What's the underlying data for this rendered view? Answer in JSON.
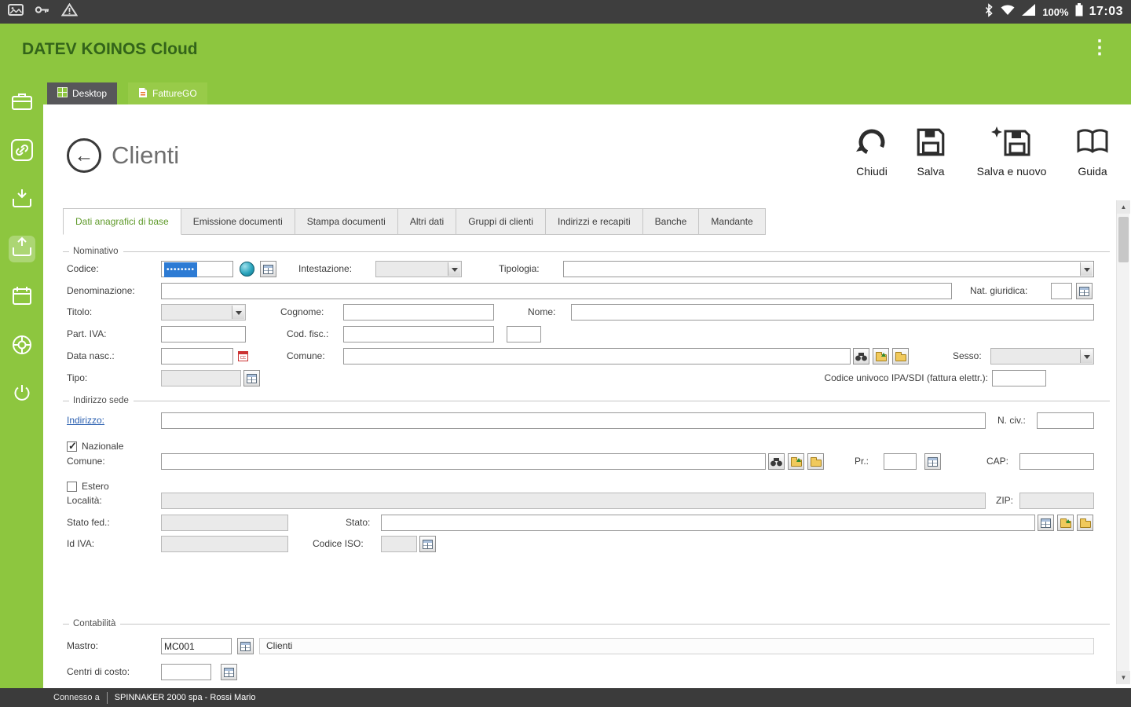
{
  "colors": {
    "accent_green": "#8dc63f",
    "selection_blue": "#2d7bd4",
    "bar_dark": "#3e3e3e"
  },
  "status_bar": {
    "time": "17:03",
    "battery": "100%"
  },
  "header": {
    "title": "DATEV KOINOS Cloud"
  },
  "window_tabs": {
    "desktop": "Desktop",
    "fatturego": "FattureGO"
  },
  "page": {
    "title": "Clienti"
  },
  "toolbar": {
    "close": "Chiudi",
    "save": "Salva",
    "save_new": "Salva e nuovo",
    "help": "Guida"
  },
  "form_tabs": [
    "Dati anagrafici di base",
    "Emissione documenti",
    "Stampa documenti",
    "Altri dati",
    "Gruppi di clienti",
    "Indirizzi e recapiti",
    "Banche",
    "Mandante"
  ],
  "nominativo": {
    "legend": "Nominativo",
    "codice": "Codice:",
    "codice_value": "••••••••",
    "intestazione": "Intestazione:",
    "tipologia": "Tipologia:",
    "denominazione": "Denominazione:",
    "nat_giuridica": "Nat. giuridica:",
    "titolo": "Titolo:",
    "cognome": "Cognome:",
    "nome": "Nome:",
    "part_iva": "Part. IVA:",
    "cod_fisc": "Cod. fisc.:",
    "data_nasc": "Data nasc.:",
    "comune": "Comune:",
    "sesso": "Sesso:",
    "tipo": "Tipo:",
    "codice_univoco": "Codice univoco IPA/SDI (fattura elettr.):"
  },
  "indirizzo": {
    "legend": "Indirizzo sede",
    "indirizzo_link": "Indirizzo:",
    "n_civ": "N. civ.:",
    "nazionale": "Nazionale",
    "comune": "Comune:",
    "pr": "Pr.:",
    "cap": "CAP:",
    "estero": "Estero",
    "localita": "Località:",
    "zip": "ZIP:",
    "stato_fed": "Stato fed.:",
    "stato": "Stato:",
    "id_iva": "Id IVA:",
    "codice_iso": "Codice ISO:"
  },
  "contabilita": {
    "legend": "Contabilità",
    "mastro": "Mastro:",
    "mastro_value": "MC001",
    "mastro_desc": "Clienti",
    "centri_costo": "Centri di costo:"
  },
  "footer": {
    "connected": "Connesso a",
    "company": "SPINNAKER 2000 spa - Rossi Mario"
  }
}
